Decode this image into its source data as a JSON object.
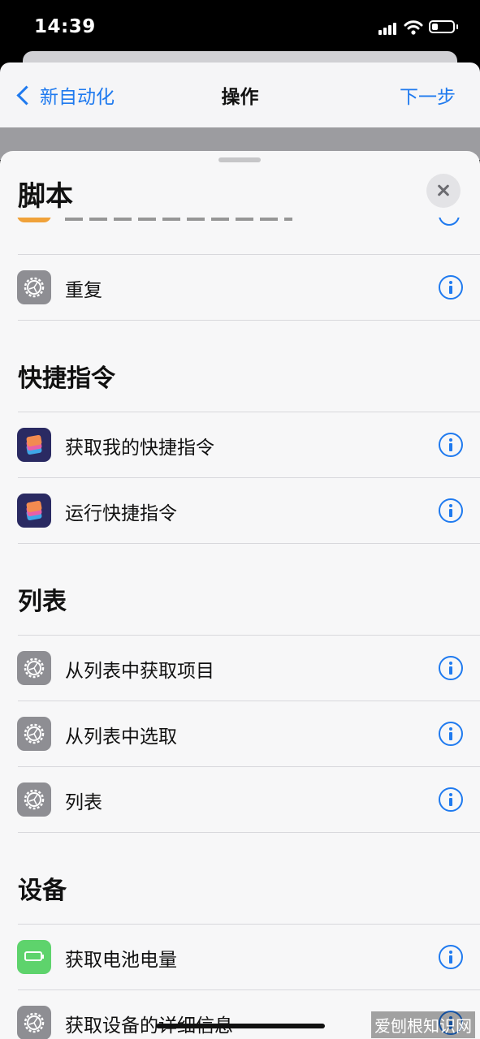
{
  "status_bar": {
    "time": "14:39"
  },
  "nav": {
    "back_label": "新自动化",
    "title": "操作",
    "next_label": "下一步"
  },
  "sheet": {
    "title": "脚本"
  },
  "rows_top": [
    {
      "label": "重复",
      "icon": "gear-icon"
    }
  ],
  "sections": [
    {
      "title": "快捷指令",
      "rows": [
        {
          "label": "获取我的快捷指令",
          "icon": "shortcuts-icon"
        },
        {
          "label": "运行快捷指令",
          "icon": "shortcuts-icon"
        }
      ]
    },
    {
      "title": "列表",
      "rows": [
        {
          "label": "从列表中获取项目",
          "icon": "gear-icon"
        },
        {
          "label": "从列表中选取",
          "icon": "gear-icon"
        },
        {
          "label": "列表",
          "icon": "gear-icon"
        }
      ]
    },
    {
      "title": "设备",
      "rows": [
        {
          "label": "获取电池电量",
          "icon": "battery-icon"
        },
        {
          "label": "获取设备的详细信息",
          "icon": "gear-icon"
        }
      ]
    }
  ],
  "watermark": "爱刨根知识网"
}
